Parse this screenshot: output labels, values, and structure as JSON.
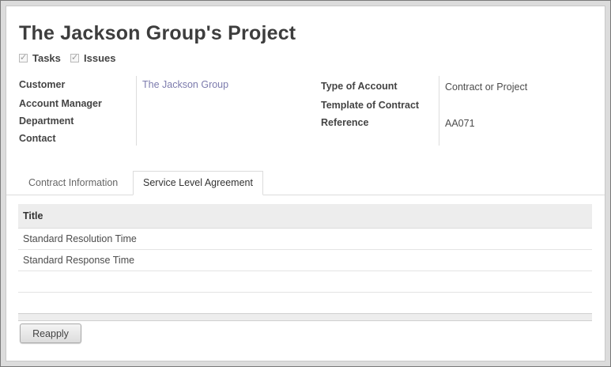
{
  "project": {
    "title": "The Jackson Group's Project",
    "options": [
      {
        "label": "Tasks",
        "checked": true
      },
      {
        "label": "Issues",
        "checked": true
      }
    ]
  },
  "left_fields": [
    {
      "label": "Customer",
      "value": "The Jackson Group"
    },
    {
      "label": "Account Manager",
      "value": ""
    },
    {
      "label": "Department",
      "value": ""
    },
    {
      "label": "Contact",
      "value": ""
    }
  ],
  "right_fields": [
    {
      "label": "Type of Account",
      "value": "Contract or Project"
    },
    {
      "label": "Template of Contract",
      "value": ""
    },
    {
      "label": "Reference",
      "value": "AA071"
    }
  ],
  "tabs": [
    {
      "label": "Contract Information",
      "active": false
    },
    {
      "label": "Service Level Agreement",
      "active": true
    }
  ],
  "sla_table": {
    "columns": [
      "Title"
    ],
    "rows": [
      "Standard Resolution Time",
      "Standard Response Time"
    ]
  },
  "actions": {
    "reapply_label": "Reapply"
  },
  "colors": {
    "link": "#7c7bad",
    "header_bg": "#ededed"
  }
}
